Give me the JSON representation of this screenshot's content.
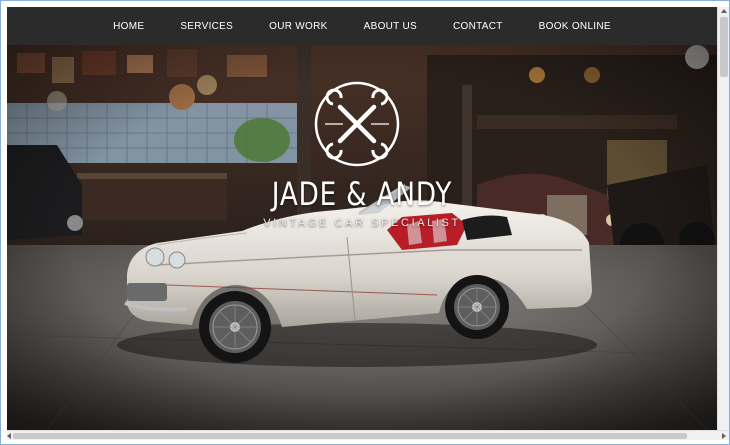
{
  "nav": {
    "items": [
      {
        "label": "HOME"
      },
      {
        "label": "SERVICES"
      },
      {
        "label": "OUR WORK"
      },
      {
        "label": "ABOUT US"
      },
      {
        "label": "CONTACT"
      },
      {
        "label": "BOOK ONLINE"
      }
    ]
  },
  "hero": {
    "title": "JADE & ANDY",
    "subtitle": "VINTAGE CAR SPECIALIST",
    "logo_icon": "crossed-wrenches-icon"
  },
  "colors": {
    "nav_bg": "#2b2b2b",
    "nav_text": "#ffffff",
    "car_body": "#e8e4de",
    "car_interior": "#c0202a"
  }
}
